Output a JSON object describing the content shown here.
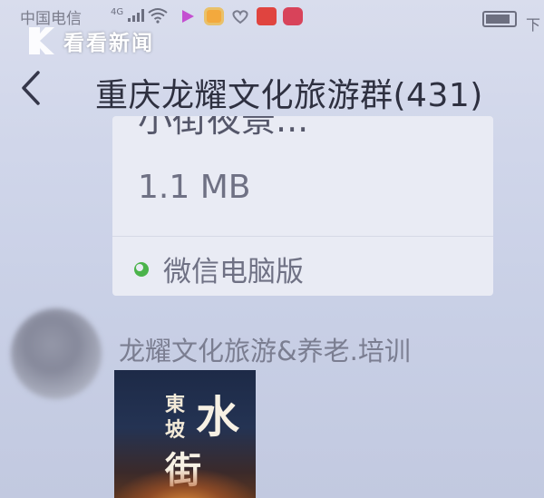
{
  "status_bar": {
    "carrier": "中国电信",
    "network": "4G",
    "icons": [
      "signal-icon",
      "wifi-icon",
      "video-app-icon",
      "photo-app-icon",
      "heart-app-icon",
      "xiaohongshu-app-icon",
      "camera-app-icon",
      "battery-icon"
    ],
    "time_partial": "下"
  },
  "watermark": {
    "text": "看看新闻"
  },
  "header": {
    "title": "重庆龙耀文化旅游群(431)"
  },
  "messages": [
    {
      "type": "file",
      "file_name": "小街夜景...",
      "file_size": "1.1 MB",
      "source_label": "微信电脑版"
    },
    {
      "type": "image",
      "sender": "龙耀文化旅游&养老.培训",
      "poster_text": {
        "dong": "東",
        "po": "坡",
        "shui": "水",
        "jie": "街"
      }
    }
  ],
  "colors": {
    "background": "#cdd3e6",
    "card": "#e9ebf4",
    "title_text": "#2e3040",
    "secondary_text": "#6f7184",
    "wechat_green": "#4bb34b"
  }
}
